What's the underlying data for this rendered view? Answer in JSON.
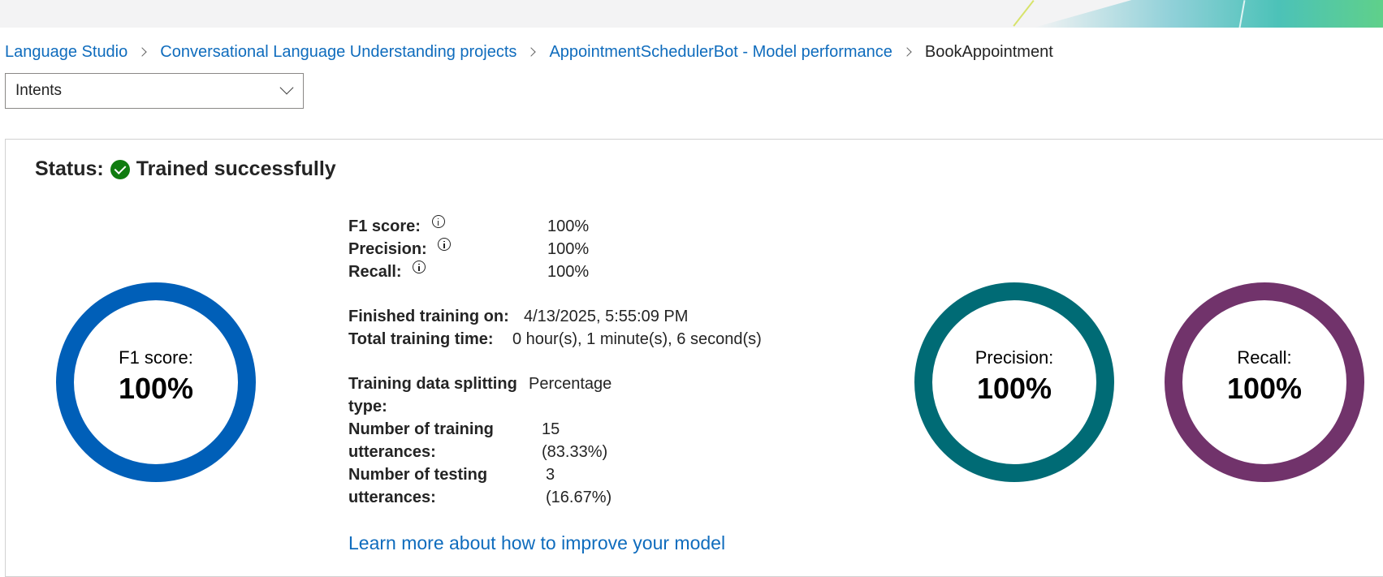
{
  "breadcrumb": {
    "items": [
      "Language Studio",
      "Conversational Language Understanding projects",
      "AppointmentSchedulerBot - Model performance"
    ],
    "current": "BookAppointment"
  },
  "view_select": {
    "value": "Intents"
  },
  "status": {
    "label": "Status:",
    "value": "Trained successfully",
    "color": "#107c10"
  },
  "metrics": {
    "f1_label": "F1 score:",
    "f1_value": "100%",
    "precision_label": "Precision:",
    "precision_value": "100%",
    "recall_label": "Recall:",
    "recall_value": "100%"
  },
  "training": {
    "finished_label": "Finished training on:",
    "finished_value": "4/13/2025, 5:55:09 PM",
    "time_label": "Total training time:",
    "time_value": "0 hour(s), 1 minute(s), 6 second(s)",
    "split_label_1": "Training data splitting",
    "split_label_2": "type:",
    "split_value": "Percentage",
    "train_label_1": "Number of training",
    "train_label_2": "utterances:",
    "train_count": "15",
    "train_pct": "(83.33%)",
    "test_label_1": "Number of testing",
    "test_label_2": "utterances:",
    "test_count": "3",
    "test_pct": "(16.67%)"
  },
  "donuts": {
    "f1": {
      "label": "F1 score:",
      "value": "100%",
      "fraction": 1.0,
      "color": "#005fb8"
    },
    "precision": {
      "label": "Precision:",
      "value": "100%",
      "fraction": 1.0,
      "color": "#006b75"
    },
    "recall": {
      "label": "Recall:",
      "value": "100%",
      "fraction": 1.0,
      "color": "#71336b"
    }
  },
  "learn_more": "Learn more about how to improve your model"
}
